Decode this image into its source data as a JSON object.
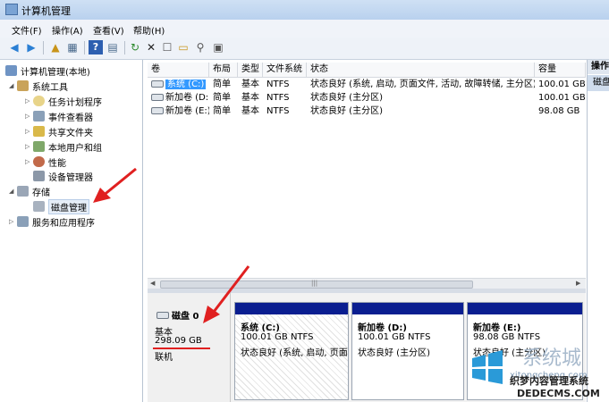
{
  "window": {
    "title": "计算机管理"
  },
  "menu": [
    "文件(F)",
    "操作(A)",
    "查看(V)",
    "帮助(H)"
  ],
  "toolbar_icons": [
    "back-icon",
    "forward-icon",
    "up-icon",
    "show-hide-tree-icon",
    "help-icon",
    "show-hide-action-icon",
    "refresh-icon",
    "delete-icon",
    "properties-icon",
    "open-icon",
    "search-icon",
    "drive-properties-icon"
  ],
  "tree": {
    "root": "计算机管理(本地)",
    "items": [
      {
        "label": "系统工具",
        "icon": "tools-icon"
      },
      {
        "label": "任务计划程序",
        "icon": "clock-icon"
      },
      {
        "label": "事件查看器",
        "icon": "event-viewer-icon"
      },
      {
        "label": "共享文件夹",
        "icon": "shared-folder-icon"
      },
      {
        "label": "本地用户和组",
        "icon": "users-icon"
      },
      {
        "label": "性能",
        "icon": "performance-icon"
      },
      {
        "label": "设备管理器",
        "icon": "device-manager-icon"
      },
      {
        "label": "存储",
        "icon": "storage-icon"
      },
      {
        "label": "磁盘管理",
        "icon": "disk-management-icon"
      },
      {
        "label": "服务和应用程序",
        "icon": "services-icon"
      }
    ]
  },
  "volume_table": {
    "headers": [
      "卷",
      "布局",
      "类型",
      "文件系统",
      "状态",
      "容量"
    ],
    "rows": [
      {
        "name": "系统 (C:)",
        "layout": "简单",
        "type": "基本",
        "fs": "NTFS",
        "status": "状态良好 (系统, 启动, 页面文件, 活动, 故障转储, 主分区)",
        "capacity": "100.01 GB"
      },
      {
        "name": "新加卷 (D:)",
        "layout": "简单",
        "type": "基本",
        "fs": "NTFS",
        "status": "状态良好 (主分区)",
        "capacity": "100.01 GB"
      },
      {
        "name": "新加卷 (E:)",
        "layout": "简单",
        "type": "基本",
        "fs": "NTFS",
        "status": "状态良好 (主分区)",
        "capacity": "98.08 GB"
      }
    ]
  },
  "disk": {
    "name": "磁盘 0",
    "type": "基本",
    "size": "298.09 GB",
    "state": "联机",
    "partitions": [
      {
        "name": "系统  (C:)",
        "size": "100.01 GB NTFS",
        "status": "状态良好 (系统, 启动, 页面"
      },
      {
        "name": "新加卷  (D:)",
        "size": "100.01 GB NTFS",
        "status": "状态良好 (主分区)"
      },
      {
        "name": "新加卷  (E:)",
        "size": "98.08 GB NTFS",
        "status": "状态良好 (主分区)"
      }
    ]
  },
  "actions": {
    "header": "操作",
    "item": "磁盘"
  },
  "watermark": {
    "brand": "系统城",
    "site": "xitongcheng.com",
    "overlay": "织梦内容管理系统",
    "overlay_site": "DEDECMS.COM"
  },
  "colors": {
    "partition_bar": "#0a1e90",
    "selection": "#3399ff",
    "annotation": "#e02020"
  }
}
